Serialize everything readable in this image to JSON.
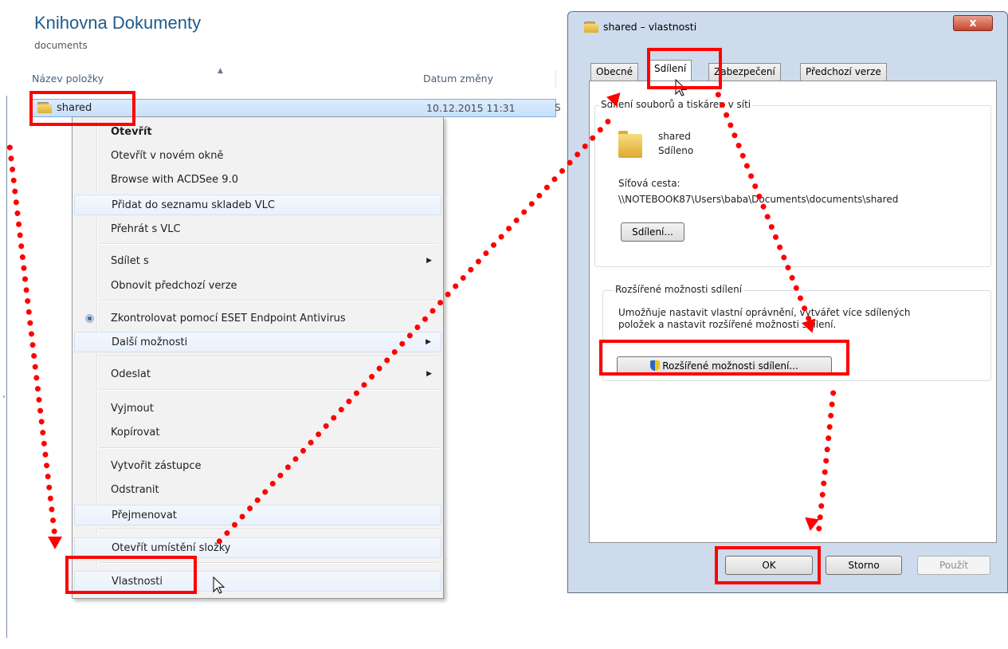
{
  "explorer": {
    "library_title": "Knihovna Dokumenty",
    "library_subtitle": "documents",
    "columns": {
      "name": "Název položky",
      "date": "Datum změny"
    },
    "row": {
      "name": "shared",
      "date": "10.12.2015 11:31",
      "extra": "S"
    }
  },
  "context_menu": {
    "items": [
      "Otevřít",
      "Otevřít v novém okně",
      "Browse with ACDSee 9.0",
      "Přidat do seznamu skladeb VLC",
      "Přehrát s VLC",
      "Sdílet s",
      "Obnovit předchozí verze",
      "Zkontrolovat pomocí ESET Endpoint Antivirus",
      "Další možnosti",
      "Odeslat",
      "Vyjmout",
      "Kopírovat",
      "Vytvořit zástupce",
      "Odstranit",
      "Přejmenovat",
      "Otevřít umístění složky",
      "Vlastnosti"
    ]
  },
  "dialog": {
    "title": "shared – vlastnosti",
    "close_label": "x",
    "tabs": [
      "Obecné",
      "Sdílení",
      "Zabezpečení",
      "Předchozí verze"
    ],
    "network_group": {
      "label": "Sdílení souborů a tiskáren v síti",
      "folder_name": "shared",
      "folder_status": "Sdíleno",
      "path_label": "Síťová cesta:",
      "path_value": "\\\\NOTEBOOK87\\Users\\baba\\Documents\\documents\\shared",
      "share_button": "Sdílení..."
    },
    "advanced_group": {
      "label": "Rozšířené možnosti sdílení",
      "description_line1": "Umožňuje nastavit vlastní oprávnění, vytvářet více sdílených",
      "description_line2": "položek a nastavit rozšířené možnosti sdílení.",
      "advanced_button": "Rozšířené možnosti sdílení..."
    },
    "buttons": {
      "ok": "OK",
      "cancel": "Storno",
      "apply": "Použít"
    }
  },
  "colors": {
    "annotation": "#ff0000",
    "library_title": "#1e5a8c",
    "selection": "#cce4fb"
  }
}
